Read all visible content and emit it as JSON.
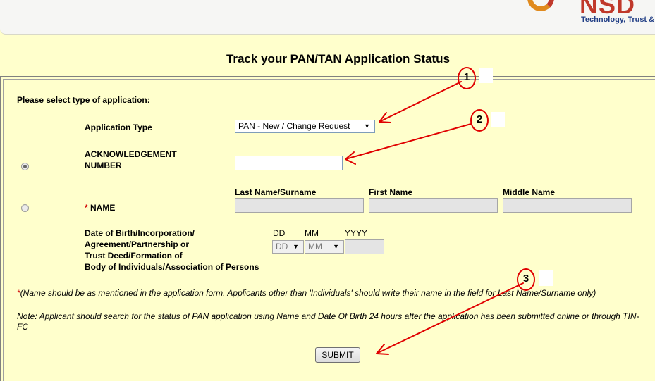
{
  "header": {
    "logo_text": "NSD",
    "tagline": "Technology, Trust &"
  },
  "page": {
    "title": "Track your PAN/TAN Application Status"
  },
  "form": {
    "select_type_label": "Please select type of application:",
    "application_type_label": "Application Type",
    "application_type_value": "PAN - New / Change Request",
    "ack_label_line1": "ACKNOWLEDGEMENT",
    "ack_label_line2": "NUMBER",
    "ack_value": "",
    "ack_selected": true,
    "name_required_mark": "*",
    "name_label": "NAME",
    "name_selected": false,
    "last_name_header": "Last Name/Surname",
    "first_name_header": "First Name",
    "middle_name_header": "Middle Name",
    "dob_label_line1": "Date of Birth/Incorporation/",
    "dob_label_line2": "Agreement/Partnership or",
    "dob_label_line3": "Trust Deed/Formation of",
    "dob_label_line4": "Body of Individuals/Association of Persons",
    "dd_header": "DD",
    "mm_header": "MM",
    "yyyy_header": "YYYY",
    "dd_value": "DD",
    "mm_value": "MM",
    "name_note_mark": "*",
    "name_note": "(Name should be as mentioned in the application form. Applicants other than 'Individuals' should write their name in the field for Last Name/Surname only)",
    "search_note": "Note: Applicant should search for the status of PAN application using Name and Date Of Birth 24 hours after the application has been submitted online or through TIN-FC",
    "submit_label": "SUBMIT"
  },
  "annotations": {
    "step1": "1",
    "step2": "2",
    "step3": "3",
    "color": "#e00000"
  }
}
